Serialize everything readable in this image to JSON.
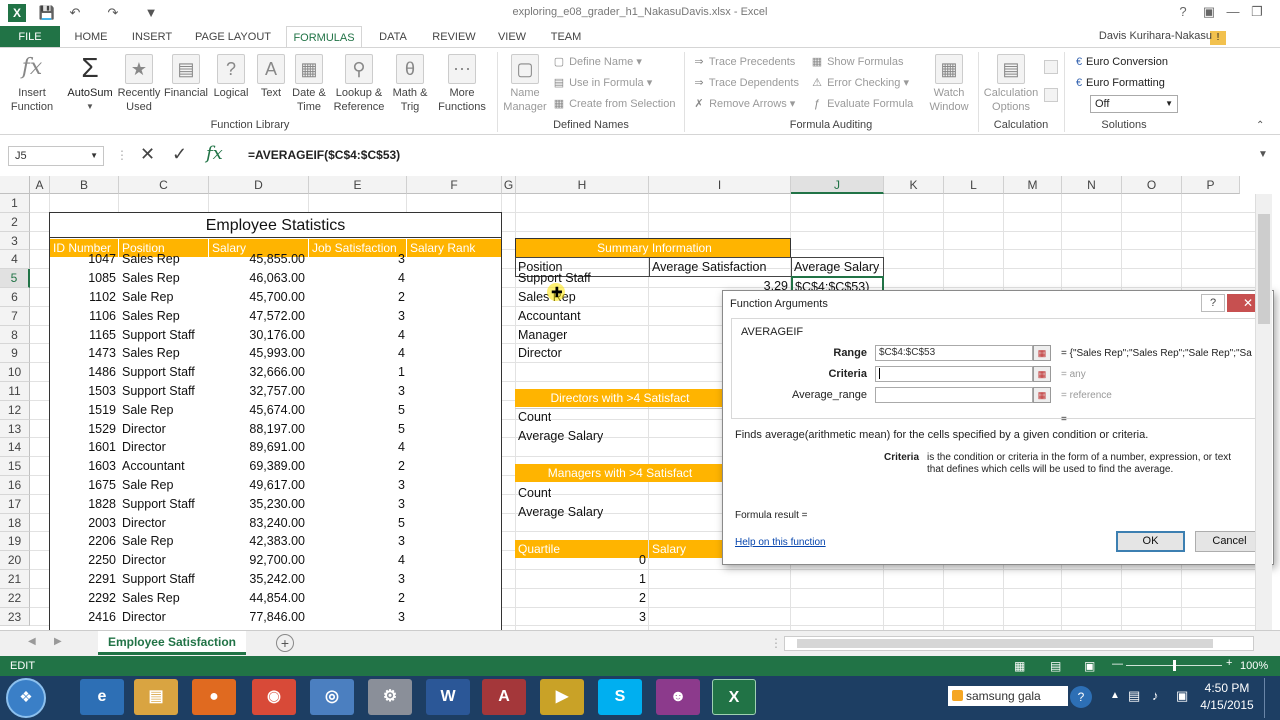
{
  "window": {
    "title": "exploring_e08_grader_h1_NakasuDavis.xlsx - Excel",
    "user": "Davis Kurihara-Nakasu"
  },
  "tabs": [
    "FILE",
    "HOME",
    "INSERT",
    "PAGE LAYOUT",
    "FORMULAS",
    "DATA",
    "REVIEW",
    "VIEW",
    "TEAM"
  ],
  "ribbon": {
    "insert_function": [
      "Insert",
      "Function"
    ],
    "autosum": "AutoSum",
    "library": [
      [
        "Recently",
        "Used"
      ],
      [
        "Financial",
        ""
      ],
      [
        "Logical",
        ""
      ],
      [
        "Text",
        ""
      ],
      [
        "Date &",
        "Time"
      ],
      [
        "Lookup &",
        "Reference"
      ],
      [
        "Math &",
        "Trig"
      ],
      [
        "More",
        "Functions"
      ]
    ],
    "library_label": "Function Library",
    "name_manager": [
      "Name",
      "Manager"
    ],
    "defined_names": [
      "Define Name",
      "Use in Formula",
      "Create from Selection"
    ],
    "defined_names_label": "Defined Names",
    "auditing_left": [
      "Trace Precedents",
      "Trace Dependents",
      "Remove Arrows"
    ],
    "auditing_right": [
      "Show Formulas",
      "Error Checking",
      "Evaluate Formula"
    ],
    "watch": [
      "Watch",
      "Window"
    ],
    "auditing_label": "Formula Auditing",
    "calc": [
      "Calculation",
      "Options"
    ],
    "calc_label": "Calculation",
    "solutions": [
      "Euro Conversion",
      "Euro Formatting"
    ],
    "solutions_select": "Off",
    "solutions_label": "Solutions"
  },
  "formula_bar": {
    "name_box": "J5",
    "formula": "=AVERAGEIF($C$4:$C$53)"
  },
  "columns": [
    "A",
    "B",
    "C",
    "D",
    "E",
    "F",
    "G",
    "H",
    "I",
    "J",
    "K",
    "L",
    "M",
    "N",
    "O",
    "P"
  ],
  "rows": [
    "1",
    "2",
    "3",
    "4",
    "5",
    "6",
    "7",
    "8",
    "9",
    "10",
    "11",
    "12",
    "13",
    "14",
    "15",
    "16",
    "17",
    "18",
    "19",
    "20",
    "21",
    "22",
    "23"
  ],
  "table": {
    "title": "Employee Statistics",
    "headers": [
      "ID Number",
      "Position",
      "Salary",
      "Job Satisfaction",
      "Salary Rank"
    ],
    "data": [
      [
        "1047",
        "Sales Rep",
        "45,855.00",
        "3"
      ],
      [
        "1085",
        "Sales Rep",
        "46,063.00",
        "4"
      ],
      [
        "1102",
        "Sale Rep",
        "45,700.00",
        "2"
      ],
      [
        "1106",
        "Sales Rep",
        "47,572.00",
        "3"
      ],
      [
        "1165",
        "Support Staff",
        "30,176.00",
        "4"
      ],
      [
        "1473",
        "Sales Rep",
        "45,993.00",
        "4"
      ],
      [
        "1486",
        "Support Staff",
        "32,666.00",
        "1"
      ],
      [
        "1503",
        "Support Staff",
        "32,757.00",
        "3"
      ],
      [
        "1519",
        "Sale Rep",
        "45,674.00",
        "5"
      ],
      [
        "1529",
        "Director",
        "88,197.00",
        "5"
      ],
      [
        "1601",
        "Director",
        "89,691.00",
        "4"
      ],
      [
        "1603",
        "Accountant",
        "69,389.00",
        "2"
      ],
      [
        "1675",
        "Sale Rep",
        "49,617.00",
        "3"
      ],
      [
        "1828",
        "Support Staff",
        "35,230.00",
        "3"
      ],
      [
        "2003",
        "Director",
        "83,240.00",
        "5"
      ],
      [
        "2206",
        "Sale Rep",
        "42,383.00",
        "3"
      ],
      [
        "2250",
        "Director",
        "92,700.00",
        "4"
      ],
      [
        "2291",
        "Support Staff",
        "35,242.00",
        "3"
      ],
      [
        "2292",
        "Sales Rep",
        "44,854.00",
        "2"
      ],
      [
        "2416",
        "Director",
        "77,846.00",
        "3"
      ]
    ]
  },
  "summary": {
    "title": "Summary Information",
    "headers": [
      "Position",
      "Average Satisfaction",
      "Average Salary"
    ],
    "positions": [
      "Support Staff",
      "Sales Rep",
      "Accountant",
      "Manager",
      "Director"
    ],
    "avg_sat_first": "3.29",
    "j5_value": "$C$4:$C$53)",
    "directors_title": "Directors with >4 Satisfact",
    "managers_title": "Managers with >4 Satisfact",
    "count": "Count",
    "avg_salary": "Average Salary",
    "quartile": "Quartile",
    "salary": "Salary",
    "quartile_values": [
      "0",
      "1",
      "2",
      "3"
    ]
  },
  "dialog": {
    "title": "Function Arguments",
    "function": "AVERAGEIF",
    "range_label": "Range",
    "range_value": "$C$4:$C$53",
    "range_result": "= {\"Sales Rep\";\"Sales Rep\";\"Sale Rep\";\"Sa",
    "criteria_label": "Criteria",
    "criteria_result": "= any",
    "avgrange_label": "Average_range",
    "avgrange_result": "= reference",
    "eq": "=",
    "description": "Finds average(arithmetic mean) for the cells specified by a given condition or criteria.",
    "arg_name": "Criteria",
    "arg_desc_1": "is the condition or criteria in the form of a number, expression, or text",
    "arg_desc_2": "that defines which cells will be used to find the average.",
    "formula_result": "Formula result =",
    "help": "Help on this function",
    "ok": "OK",
    "cancel": "Cancel"
  },
  "sheet_tab": "Employee Satisfaction",
  "status": {
    "mode": "EDIT",
    "zoom": "100%"
  },
  "taskbar": {
    "search": "samsung gala",
    "time": "4:50 PM",
    "date": "4/15/2015"
  },
  "colors": {
    "excel_green": "#217346",
    "orange": "#ffb400",
    "taskbar": "#1d3e63"
  }
}
